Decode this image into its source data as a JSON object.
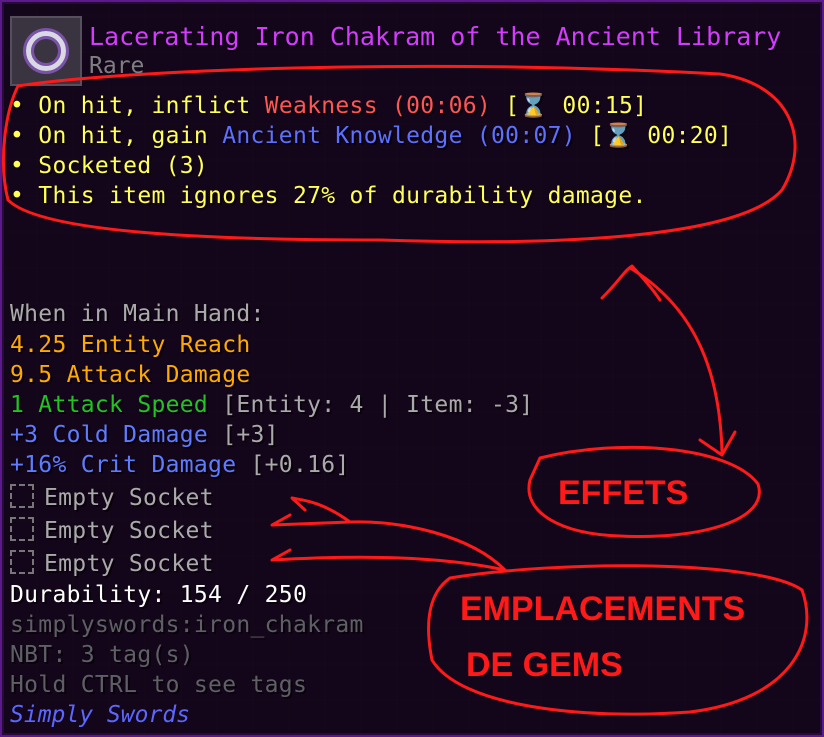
{
  "item": {
    "title": "Lacerating Iron Chakram of the Ancient Library",
    "rarity": "Rare",
    "icon": "chakram-icon"
  },
  "effects": [
    {
      "bullet": "•",
      "pre": " On hit, inflict ",
      "name": "Weakness",
      "duration": " (00:06) ",
      "cooldown": "[⌛ 00:15]"
    },
    {
      "bullet": "•",
      "pre": " On hit, gain ",
      "name": "Ancient Knowledge",
      "duration": " (00:07) ",
      "cooldown": "[⌛ 00:20]"
    }
  ],
  "socketed_line": "• Socketed (3)",
  "durability_line": "• This item ignores 27% of durability damage.",
  "main_hand": {
    "header": "When in Main Hand:",
    "reach": " 4.25 Entity Reach",
    "damage": " 9.5 Attack Damage",
    "speed": " 1 Attack Speed",
    "speed_detail": " [Entity: 4 | Item: -3]",
    "cold": "+3 Cold Damage",
    "cold_detail": " [+3]",
    "crit": "+16% Crit Damage",
    "crit_detail": " [+0.16]"
  },
  "sockets": [
    "Empty Socket",
    "Empty Socket",
    "Empty Socket"
  ],
  "durability": "Durability: 154 / 250",
  "item_id": "simplyswords:iron_chakram",
  "nbt": "NBT: 3 tag(s)",
  "hint": "Hold CTRL to see tags",
  "mod": "Simply Swords",
  "annotations": {
    "effects_label": "EFFETS",
    "sockets_label_1": "EMPLACEMENTS",
    "sockets_label_2": "DE GEMS",
    "color": "#ff1a1a"
  },
  "colors": {
    "title": "#d43bff",
    "effect_text": "#ffff55",
    "weakness": "#ff5555",
    "knowledge": "#5d70ff",
    "reach_damage": "#ffaa00",
    "speed": "#22c322",
    "modifier": "#5f7bff"
  }
}
